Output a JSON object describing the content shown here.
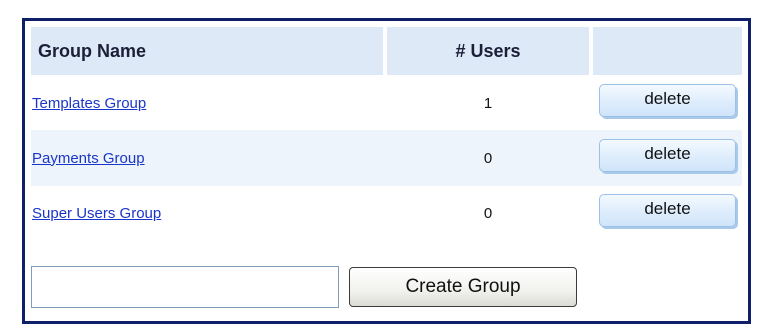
{
  "table": {
    "headers": {
      "group_name": "Group Name",
      "users": "# Users",
      "actions": ""
    },
    "rows": [
      {
        "name": "Templates Group",
        "users": "1",
        "action": "delete"
      },
      {
        "name": "Payments Group",
        "users": "0",
        "action": "delete"
      },
      {
        "name": "Super Users Group",
        "users": "0",
        "action": "delete"
      }
    ]
  },
  "create": {
    "input_value": "",
    "button_label": "Create Group"
  },
  "colors": {
    "border": "#101f6a",
    "header_bg": "#dde9f7",
    "link": "#1a36c8",
    "alt_row_bg": "#eef4fb"
  }
}
